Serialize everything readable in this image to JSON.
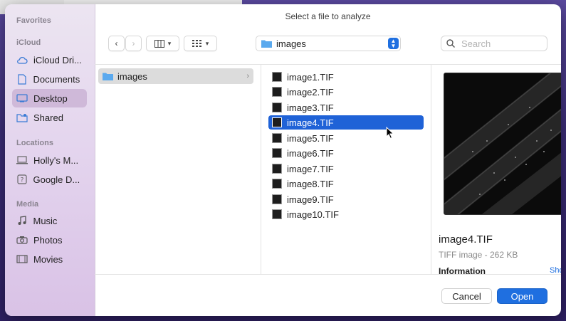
{
  "dialog": {
    "title": "Select a file to analyze"
  },
  "sidebar": {
    "favorites_header": "Favorites",
    "icloud_header": "iCloud",
    "locations_header": "Locations",
    "media_header": "Media",
    "items": [
      {
        "label": "iCloud Dri...",
        "icon": "cloud-icon"
      },
      {
        "label": "Documents",
        "icon": "document-icon"
      },
      {
        "label": "Desktop",
        "icon": "desktop-icon",
        "selected": true
      },
      {
        "label": "Shared",
        "icon": "shared-folder-icon"
      },
      {
        "label": "Holly's M...",
        "icon": "laptop-icon"
      },
      {
        "label": "Google D...",
        "icon": "drive-icon"
      },
      {
        "label": "Music",
        "icon": "music-icon"
      },
      {
        "label": "Photos",
        "icon": "camera-icon"
      },
      {
        "label": "Movies",
        "icon": "film-icon"
      }
    ]
  },
  "toolbar": {
    "path_label": "images",
    "search_placeholder": "Search"
  },
  "browser": {
    "folder": "images",
    "files": [
      "image1.TIF",
      "image2.TIF",
      "image3.TIF",
      "image4.TIF",
      "image5.TIF",
      "image6.TIF",
      "image7.TIF",
      "image8.TIF",
      "image9.TIF",
      "image10.TIF"
    ],
    "selected_file": "image4.TIF"
  },
  "preview": {
    "name": "image4.TIF",
    "kind": "TIFF image - 262 KB",
    "info_label": "Information",
    "show_more": "Sho"
  },
  "buttons": {
    "cancel": "Cancel",
    "open": "Open"
  },
  "colors": {
    "accent": "#1f6fe0",
    "selection": "#1f62d7"
  }
}
